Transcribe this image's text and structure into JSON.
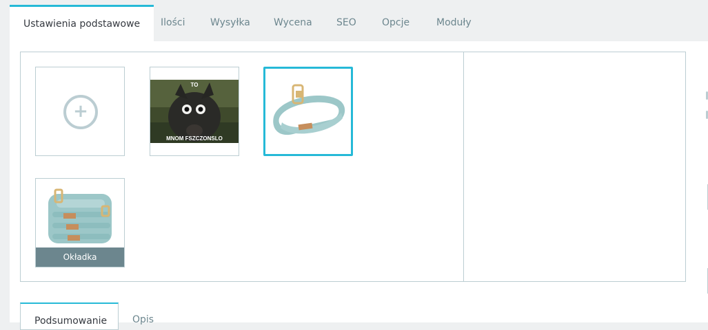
{
  "tabs": [
    {
      "label": "Ustawienia podstawowe",
      "active": true
    },
    {
      "label": "Ilości"
    },
    {
      "label": "Wysyłka"
    },
    {
      "label": "Wycena"
    },
    {
      "label": "SEO"
    },
    {
      "label": "Opcje"
    },
    {
      "label": "Moduły"
    }
  ],
  "images": {
    "add_glyph": "+",
    "meme_top_text": "TO",
    "meme_bottom_text": "MNOM FSZCZONSLO",
    "cover_label": "Okładka"
  },
  "subtabs": [
    {
      "label": "Podsumowanie",
      "active": true
    },
    {
      "label": "Opis"
    }
  ],
  "colors": {
    "accent": "#25b9d7",
    "border": "#bbcdd2",
    "muted": "#6c868e"
  }
}
